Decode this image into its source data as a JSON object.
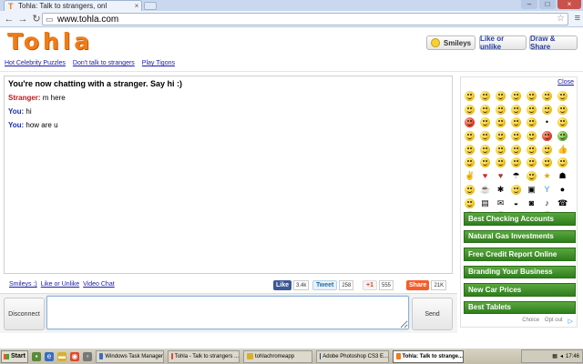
{
  "browser": {
    "tab_title": "Tohla: Talk to strangers, onl",
    "tab_favicon": "T",
    "url": "www.tohla.com"
  },
  "site": {
    "logo": "Tohla",
    "header_buttons": {
      "smileys": "Smileys",
      "like": "Like or unlike",
      "draw": "Draw & Share"
    },
    "top_links": [
      "Hot Celebrity Puzzles",
      "Don't talk to strangers",
      "Play Tigons"
    ]
  },
  "chat": {
    "system_message": "You're now chatting with a stranger. Say hi :)",
    "messages": [
      {
        "who": "Stranger:",
        "text": " m here",
        "role": "stranger"
      },
      {
        "who": "You:",
        "text": " hi",
        "role": "you"
      },
      {
        "who": "You:",
        "text": " how are u",
        "role": "you"
      }
    ]
  },
  "bottom_links": [
    "Smileys :)",
    "Like or Unlike",
    "Video Chat"
  ],
  "social": {
    "fb_label": "Like",
    "fb_count": "3.4k",
    "tweet_label": "Tweet",
    "tweet_count": "258",
    "gplus_label": "+1",
    "gplus_count": "555",
    "share_label": "Share",
    "share_count": "21K"
  },
  "compose": {
    "disconnect_label": "Disconnect",
    "input_value": "",
    "send_label": "Send"
  },
  "right_panel": {
    "close_label": "Close",
    "ads": [
      "Best Checking Accounts",
      "Natural Gas Investments",
      "Free Credit Report Online",
      "Branding Your Business",
      "New Car Prices",
      "Best Tablets"
    ],
    "adchoices": [
      "Choice",
      "Opt out"
    ]
  },
  "taskbar": {
    "start_label": "Start",
    "tasks": [
      "Windows Task Manager",
      "Tohla - Talk to strangers ...",
      "tohlachromeapp",
      "Adobe Photoshop CS3 E...",
      "Tohla: Talk to strange..."
    ],
    "clock": "17:46"
  }
}
